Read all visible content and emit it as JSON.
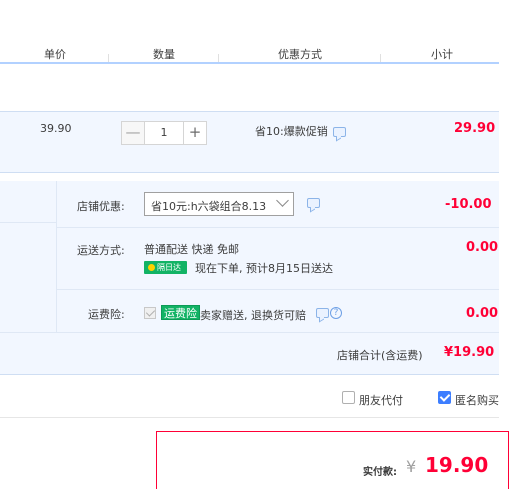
{
  "header": {
    "unit_price": "单价",
    "quantity": "数量",
    "discount_method": "优惠方式",
    "subtotal": "小计"
  },
  "item": {
    "price": "39.90",
    "quantity": "1",
    "minus": "—",
    "plus": "+",
    "promo": "省10:爆款促销",
    "subtotal": "29.90"
  },
  "shop": {
    "discount_label": "店铺优惠:",
    "discount_selected": "省10元:h六袋组合8.13",
    "discount_amount": "-10.00",
    "shipping_label": "运送方式:",
    "shipping_method": "普通配送 快递 免邮",
    "next_day_badge": "隔日达",
    "delivery_note": "现在下单, 预计8月15日送达",
    "shipping_amount": "0.00",
    "insurance_label": "运费险:",
    "insurance_badge": "运费险",
    "insurance_text": "卖家赠送, 退换货可赔",
    "insurance_help": "?",
    "insurance_amount": "0.00",
    "total_label": "店铺合计(含运费)",
    "total_amount": "¥19.90"
  },
  "options": {
    "friend_pay": "朋友代付",
    "anonymous": "匿名购买",
    "friend_pay_checked": false,
    "anonymous_checked": true
  },
  "payment": {
    "label": "实付款:",
    "currency": "¥",
    "amount": "19.90"
  },
  "colors": {
    "accent": "#ff0036",
    "panel_bg": "#f2f7ff",
    "header_line": "#b2d1ff",
    "green_badge": "#12b365",
    "checkbox_blue": "#3d7eff"
  }
}
